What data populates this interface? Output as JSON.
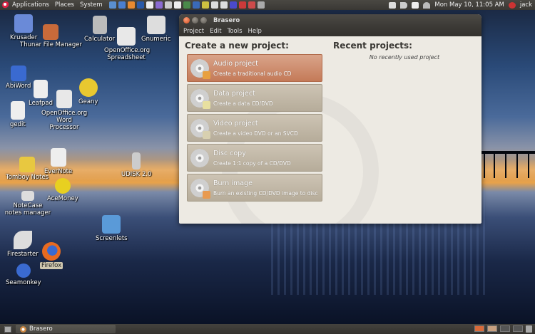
{
  "top_panel": {
    "menus": [
      "Applications",
      "Places",
      "System"
    ],
    "clock": "Mon May 10, 11:05 AM",
    "user": "jack",
    "launcher_colors": [
      "#5a8fd0",
      "#4a7fd0",
      "#e88a30",
      "#2a5aa8",
      "#eee",
      "#8a6ad0",
      "#ccc",
      "#eee",
      "#4a8a4a",
      "#3a6ab8",
      "#d0c040",
      "#ddd",
      "#ddd",
      "#4a4acc",
      "#cc3a3a",
      "#cc4a4a",
      "#aaa"
    ]
  },
  "desktop_icons": [
    {
      "label": "Krusader",
      "icon": "krusader-icon",
      "color": "#6a8ad8"
    },
    {
      "label": "Thunar File Manager",
      "icon": "thunar-icon",
      "color": "#c86a3a"
    },
    {
      "label": "Calculator",
      "icon": "calculator-icon",
      "color": "#bbbbbb"
    },
    {
      "label": "OpenOffice.org Spreadsheet",
      "icon": "spreadsheet-icon",
      "color": "#e8e8e8"
    },
    {
      "label": "Gnumeric",
      "icon": "gnumeric-icon",
      "color": "#dddddd"
    },
    {
      "label": "AbiWord",
      "icon": "abiword-icon",
      "color": "#3a6ad0"
    },
    {
      "label": "Leafpad",
      "icon": "leafpad-icon",
      "color": "#eeeeee"
    },
    {
      "label": "OpenOffice.org Word Processor",
      "icon": "writer-icon",
      "color": "#e8e8e8"
    },
    {
      "label": "Geany",
      "icon": "geany-icon",
      "color": "#e8c830"
    },
    {
      "label": "gedit",
      "icon": "gedit-icon",
      "color": "#eeeeee"
    },
    {
      "label": "Tomboy Notes",
      "icon": "tomboy-icon",
      "color": "#e8c840"
    },
    {
      "label": "EverNote",
      "icon": "evernote-icon",
      "color": "#eeeeee"
    },
    {
      "label": "UDISK 2.0",
      "icon": "usb-drive-icon",
      "color": "#cccccc"
    },
    {
      "label": "AceMoney",
      "icon": "acemoney-icon",
      "color": "#e8d020"
    },
    {
      "label": "NoteCase notes manager",
      "icon": "notecase-icon",
      "color": "#dddddd"
    },
    {
      "label": "Screenlets",
      "icon": "screenlets-icon",
      "color": "#5a9ad8"
    },
    {
      "label": "Firestarter",
      "icon": "firestarter-icon",
      "color": "#dddddd"
    },
    {
      "label": "Firefox",
      "icon": "firefox-icon",
      "color": "#e86a20"
    },
    {
      "label": "Seamonkey",
      "icon": "seamonkey-icon",
      "color": "#3a6ad0"
    }
  ],
  "window": {
    "title": "Brasero",
    "menus": [
      "Project",
      "Edit",
      "Tools",
      "Help"
    ],
    "create_title": "Create a new project:",
    "recent_title": "Recent projects:",
    "recent_empty": "No recently used project",
    "projects": [
      {
        "name": "Audio project",
        "desc": "Create a traditional audio CD",
        "badge_color": "#e8a040"
      },
      {
        "name": "Data project",
        "desc": "Create a data CD/DVD",
        "badge_color": "#e8e0a0"
      },
      {
        "name": "Video project",
        "desc": "Create a video DVD or an SVCD",
        "badge_color": "#d8d0b0"
      },
      {
        "name": "Disc copy",
        "desc": "Create 1:1 copy of a CD/DVD",
        "badge_color": "#cccccc"
      },
      {
        "name": "Burn image",
        "desc": "Burn an existing CD/DVD image to disc",
        "badge_color": "#e89a50"
      }
    ]
  },
  "bottom_panel": {
    "task_label": "Brasero"
  },
  "colors": {
    "panel": "#3a3834",
    "window_bg": "#edeae3",
    "hover_button": "#c47a58",
    "button": "#b6ac9a"
  }
}
